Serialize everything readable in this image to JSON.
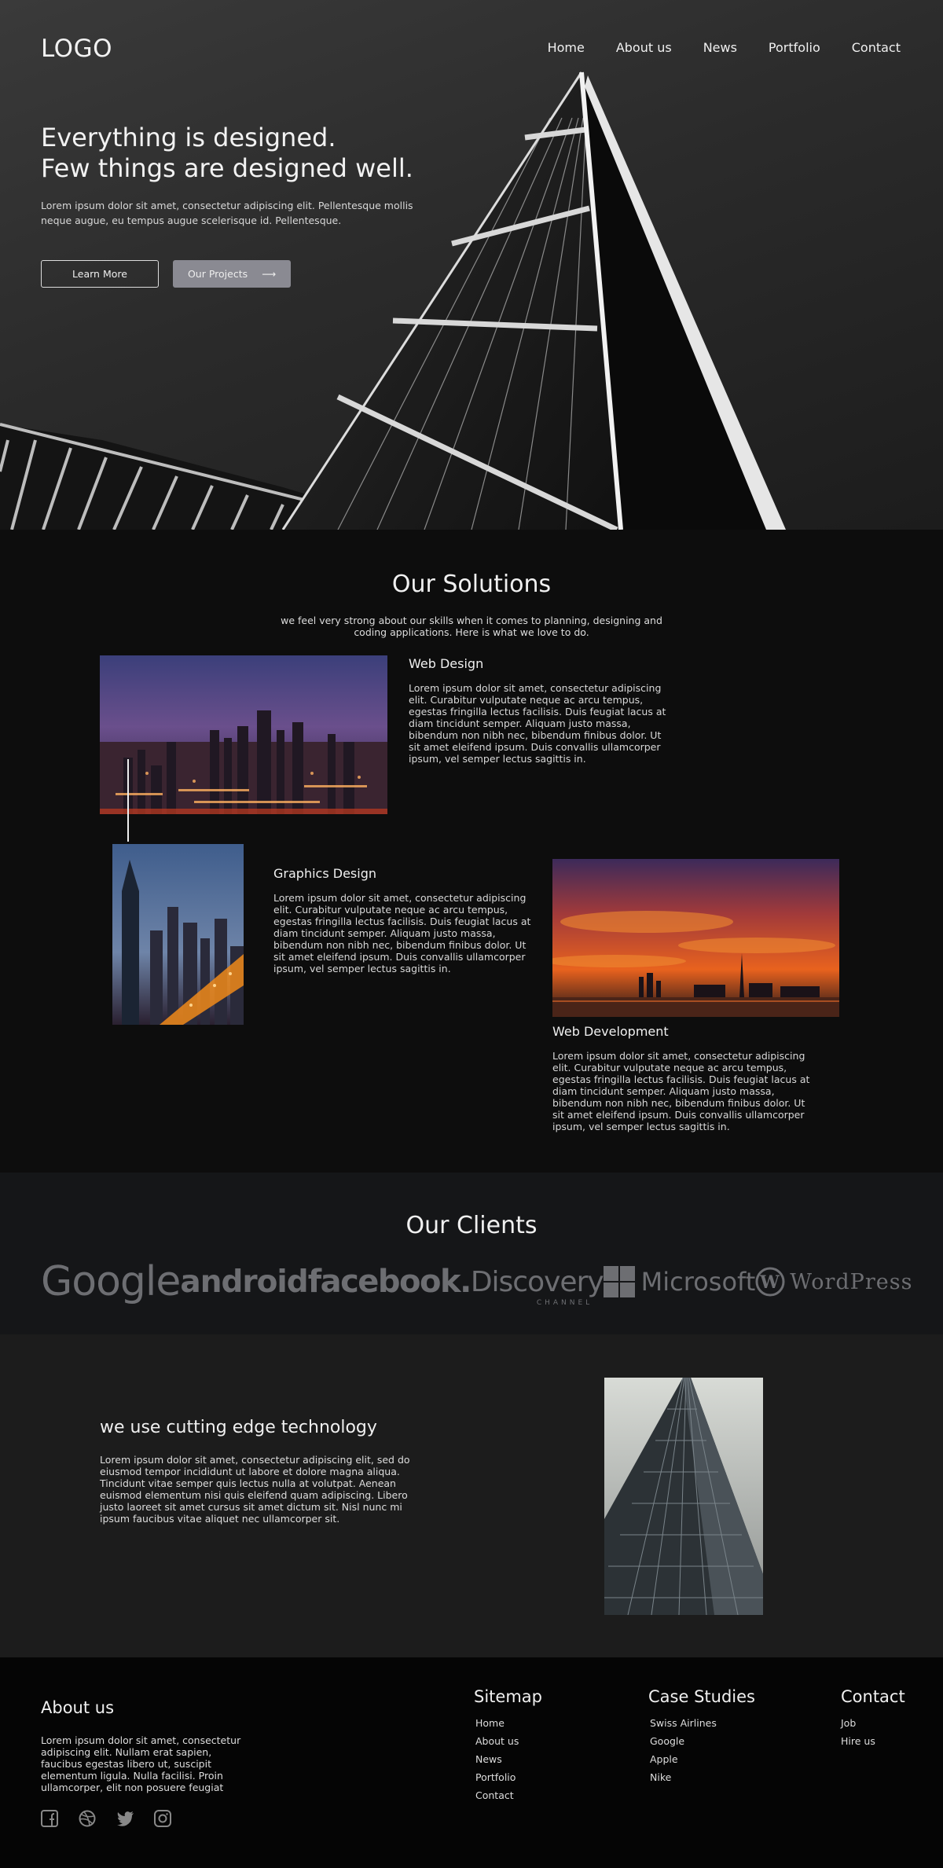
{
  "header": {
    "logo": "LOGO",
    "nav": [
      "Home",
      "About us",
      "News",
      "Portfolio",
      "Contact"
    ]
  },
  "hero": {
    "title_line1": "Everything is designed.",
    "title_line2": "Few things are designed well.",
    "text": "Lorem ipsum dolor sit amet, consectetur adipiscing elit. Pellentesque mollis neque augue, eu tempus augue scelerisque id. Pellentesque.",
    "btn_learn": "Learn More",
    "btn_projects": "Our Projects",
    "btn_projects_arrow": "⟶"
  },
  "solutions": {
    "title": "Our Solutions",
    "intro": "we feel very strong about our skills when it comes to planning, designing and coding applications. Here is what we love to do.",
    "items": [
      {
        "title": "Web Design",
        "text": "Lorem ipsum dolor sit amet, consectetur adipiscing elit. Curabitur vulputate neque ac arcu tempus, egestas fringilla lectus facilisis. Duis feugiat lacus at diam tincidunt semper. Aliquam justo massa, bibendum non nibh nec, bibendum finibus dolor. Ut sit amet eleifend ipsum. Duis convallis ullamcorper ipsum, vel semper lectus sagittis in."
      },
      {
        "title": "Graphics Design",
        "text": "Lorem ipsum dolor sit amet, consectetur adipiscing elit. Curabitur vulputate neque ac arcu tempus, egestas fringilla lectus facilisis. Duis feugiat lacus at diam tincidunt semper. Aliquam justo massa, bibendum non nibh nec, bibendum finibus dolor. Ut sit amet eleifend ipsum. Duis convallis ullamcorper ipsum, vel semper lectus sagittis in."
      },
      {
        "title": "Web Development",
        "text": "Lorem ipsum dolor sit amet, consectetur adipiscing elit. Curabitur vulputate neque ac arcu tempus, egestas fringilla lectus facilisis. Duis feugiat lacus at diam tincidunt semper. Aliquam justo massa, bibendum non nibh nec, bibendum finibus dolor. Ut sit amet eleifend ipsum. Duis convallis ullamcorper ipsum, vel semper lectus sagittis in."
      }
    ]
  },
  "clients": {
    "title": "Our Clients",
    "logos": {
      "google": "Google",
      "android": "android",
      "facebook": "facebook.",
      "discovery": "Discovery",
      "discovery_sub": "CHANNEL",
      "microsoft": "Microsoft",
      "wordpress": "WordPress"
    }
  },
  "tech": {
    "title": "we use cutting edge technology",
    "text": "Lorem ipsum dolor sit amet, consectetur adipiscing elit, sed do eiusmod tempor incididunt ut labore et dolore magna aliqua. Tincidunt vitae semper quis lectus nulla at volutpat. Aenean euismod elementum nisi quis eleifend quam adipiscing. Libero justo laoreet sit amet cursus sit amet dictum sit. Nisl nunc mi ipsum faucibus vitae aliquet nec ullamcorper sit."
  },
  "footer": {
    "about_title": "About us",
    "about_text": "Lorem ipsum dolor sit amet, consectetur adipiscing elit. Nullam erat sapien, faucibus egestas libero ut, suscipit elementum ligula. Nulla facilisi. Proin ullamcorper, elit non posuere feugiat",
    "social_icons": [
      "facebook-icon",
      "dribbble-icon",
      "twitter-icon",
      "instagram-icon"
    ],
    "sitemap_title": "Sitemap",
    "sitemap": [
      "Home",
      "About us",
      "News",
      "Portfolio",
      "Contact"
    ],
    "cases_title": "Case Studies",
    "cases": [
      "Swiss Airlines",
      "Google",
      "Apple",
      "Nike"
    ],
    "contact_title": "Contact",
    "contact": [
      "Job",
      "Hire us"
    ]
  },
  "colors": {
    "hero_bg": "#2b2b2b",
    "solutions_bg": "#0d0d0d",
    "clients_bg": "#151618",
    "tech_bg": "#1c1c1c",
    "footer_bg": "#050505",
    "button_accent": "#8a8a92"
  }
}
